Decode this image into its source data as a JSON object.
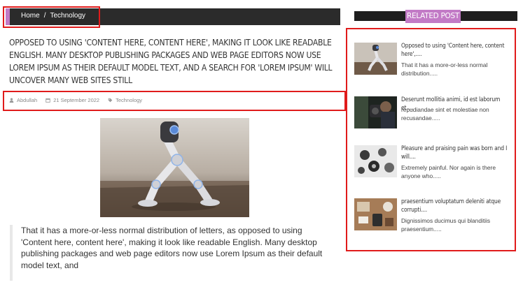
{
  "breadcrumb": {
    "home": "Home",
    "separator": "/",
    "current": "Technology"
  },
  "post": {
    "title": "Opposed to using 'Content here, content here', making it look like readable English. Many desktop publishing packages and web page editors now use Lorem Ipsum as their default model text, and a search for 'lorem ipsum' will uncover many web sites still",
    "author": "Abdullah",
    "date": "21 September 2022",
    "category": "Technology",
    "body": "That it has a more-or-less normal distribution of letters, as opposed to using 'Content here, content here', making it look like readable English. Many desktop publishing packages and web page editors now use Lorem Ipsum as their default model text, and"
  },
  "sidebar": {
    "heading": "RELATED POST",
    "items": [
      {
        "title": "Opposed to using 'Content here, content here',....",
        "excerpt": "That it has a more-or-less normal distribution....."
      },
      {
        "title": "Deserunt mollitia animi, id est laborum et....",
        "excerpt": "repudiandae sint et molestiae non recusandae....."
      },
      {
        "title": "Pleasure and praising pain was born and I will....",
        "excerpt": "Extremely painful. Nor again is there anyone who....."
      },
      {
        "title": "praesentium voluptatum deleniti atque corrupti....",
        "excerpt": "Dignissimos ducimus qui blanditiis praesentium....."
      }
    ]
  },
  "colors": {
    "accent": "#c27ac6",
    "highlight": "#e01b1b",
    "dark_bar": "#2b2b2b"
  },
  "icons": {
    "author": "user-icon",
    "date": "calendar-icon",
    "category": "tag-icon"
  }
}
